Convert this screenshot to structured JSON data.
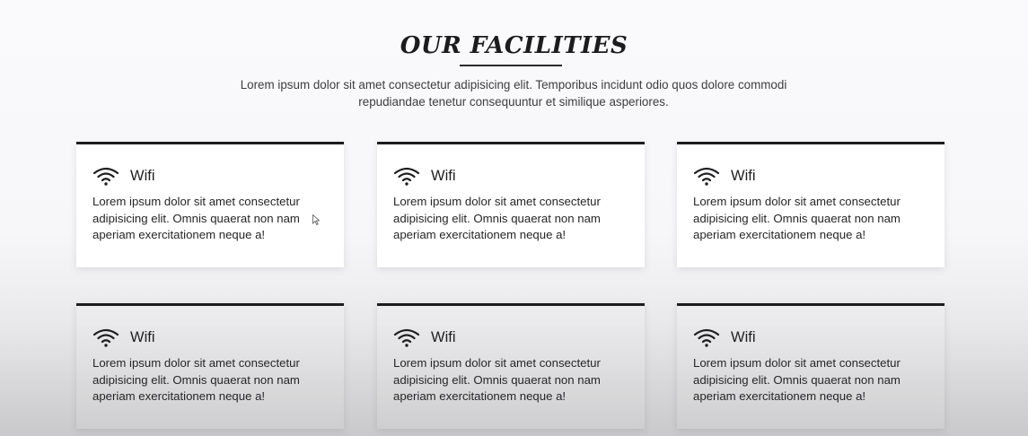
{
  "section": {
    "title": "OUR FACILITIES",
    "intro": "Lorem ipsum dolor sit amet consectetur adipisicing elit. Temporibus incidunt odio quos dolore commodi repudiandae tenetur consequuntur et similique asperiores."
  },
  "facilities": [
    {
      "title": "Wifi",
      "icon": "wifi-icon",
      "text": "Lorem ipsum dolor sit amet consectetur adipisicing elit. Omnis quaerat non nam aperiam exercitationem neque a!"
    },
    {
      "title": "Wifi",
      "icon": "wifi-icon",
      "text": "Lorem ipsum dolor sit amet consectetur adipisicing elit. Omnis quaerat non nam aperiam exercitationem neque a!"
    },
    {
      "title": "Wifi",
      "icon": "wifi-icon",
      "text": "Lorem ipsum dolor sit amet consectetur adipisicing elit. Omnis quaerat non nam aperiam exercitationem neque a!"
    },
    {
      "title": "Wifi",
      "icon": "wifi-icon",
      "text": "Lorem ipsum dolor sit amet consectetur adipisicing elit. Omnis quaerat non nam aperiam exercitationem neque a!"
    },
    {
      "title": "Wifi",
      "icon": "wifi-icon",
      "text": "Lorem ipsum dolor sit amet consectetur adipisicing elit. Omnis quaerat non nam aperiam exercitationem neque a!"
    },
    {
      "title": "Wifi",
      "icon": "wifi-icon",
      "text": "Lorem ipsum dolor sit amet consectetur adipisicing elit. Omnis quaerat non nam aperiam exercitationem neque a!"
    }
  ],
  "colors": {
    "card_border": "#1d1d1f",
    "heading": "#1c1c1e",
    "text": "#262628"
  }
}
